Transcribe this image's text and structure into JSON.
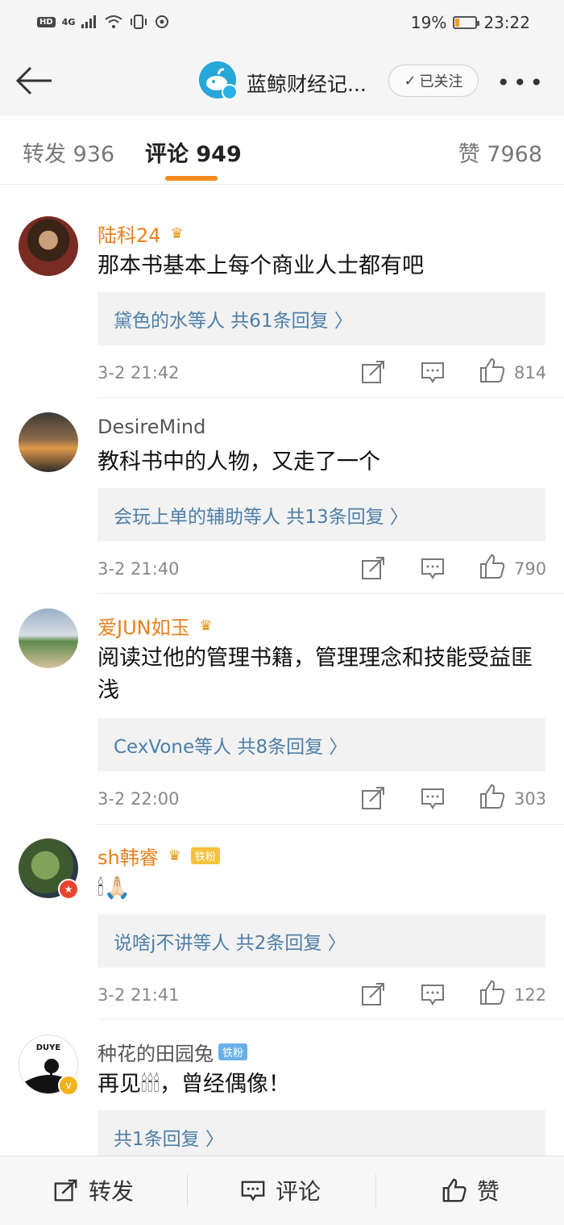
{
  "status_bar": {
    "hd": "HD",
    "signal": "4G",
    "battery_percent": "19%",
    "battery_level": 0.19,
    "time": "23:22"
  },
  "nav": {
    "title": "蓝鲸财经记...",
    "follow_label": "已关注",
    "more": "•••"
  },
  "tabs": {
    "repost": "转发 936",
    "comments": "评论 949",
    "likes": "赞 7968"
  },
  "comments": [
    {
      "name": "陆科24",
      "text": "那本书基本上每个商业人士都有吧",
      "reply_summary": "黛色的水等人 共61条回复 〉",
      "time": "3-2 21:42",
      "likes": "814"
    },
    {
      "name": "DesireMind",
      "text": "教科书中的人物，又走了一个",
      "reply_summary": "会玩上单的辅助等人 共13条回复 〉",
      "time": "3-2 21:40",
      "likes": "790"
    },
    {
      "name": "爱JUN如玉",
      "text": "阅读过他的管理书籍，管理理念和技能受益匪浅",
      "reply_summary": "CexVone等人 共8条回复 〉",
      "time": "3-2 22:00",
      "likes": "303"
    },
    {
      "name": "sh韩睿",
      "fan_badge": "铁粉",
      "text": "🕯🙏🏻",
      "reply_summary": "说啥j不讲等人 共2条回复 〉",
      "time": "3-2 21:41",
      "likes": "122"
    },
    {
      "name": "种花的田园兔",
      "fan_badge": "铁粉",
      "avatar_text": "DUYE",
      "text": "再见🕯🕯🕯，曾经偶像！",
      "reply_summary": "共1条回复 〉"
    }
  ],
  "bottom_bar": {
    "repost": "转发",
    "comment": "评论",
    "like": "赞"
  }
}
